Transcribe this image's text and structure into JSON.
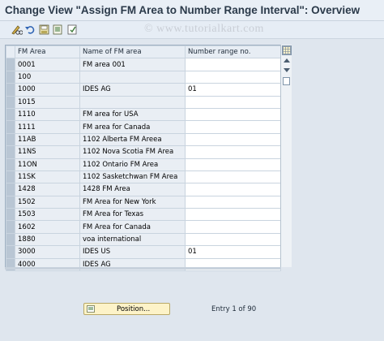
{
  "window": {
    "title": "Change View \"Assign FM Area to Number Range Interval\": Overview"
  },
  "watermark": "© www.tutorialkart.com",
  "toolbar": {
    "buttons": [
      {
        "icon": "pencil-glasses-icon"
      },
      {
        "icon": "undo-icon"
      },
      {
        "icon": "save-icon"
      },
      {
        "icon": "export-icon"
      },
      {
        "icon": "select-all-icon"
      }
    ]
  },
  "table": {
    "headers": [
      "FM Area",
      "Name of FM area",
      "Number range no."
    ],
    "rows": [
      {
        "area": "0001",
        "name": "FM area 001",
        "range": ""
      },
      {
        "area": "100",
        "name": "",
        "range": ""
      },
      {
        "area": "1000",
        "name": "IDES AG",
        "range": "01"
      },
      {
        "area": "1015",
        "name": "",
        "range": ""
      },
      {
        "area": "1110",
        "name": "FM area for USA",
        "range": ""
      },
      {
        "area": "1111",
        "name": "FM area for Canada",
        "range": ""
      },
      {
        "area": "11AB",
        "name": "1102 Alberta FM Areea",
        "range": ""
      },
      {
        "area": "11NS",
        "name": "1102 Nova Scotia FM Area",
        "range": ""
      },
      {
        "area": "11ON",
        "name": "1102 Ontario FM Area",
        "range": ""
      },
      {
        "area": "11SK",
        "name": "1102 Sasketchwan FM Area",
        "range": ""
      },
      {
        "area": "1428",
        "name": "1428 FM Area",
        "range": ""
      },
      {
        "area": "1502",
        "name": "FM Area for New York",
        "range": ""
      },
      {
        "area": "1503",
        "name": "FM Area for Texas",
        "range": ""
      },
      {
        "area": "1602",
        "name": "FM Area for Canada",
        "range": ""
      },
      {
        "area": "1880",
        "name": "voa international",
        "range": ""
      },
      {
        "area": "3000",
        "name": "IDES US",
        "range": "01"
      },
      {
        "area": "4000",
        "name": "IDES AG",
        "range": ""
      }
    ]
  },
  "footer": {
    "position_label": "Position...",
    "entry_text": "Entry 1 of 90"
  },
  "colors": {
    "background": "#dfe6ee",
    "key_cell": "#e9eef4",
    "selector": "#b9c6d4",
    "button": "#fdf3c8"
  }
}
